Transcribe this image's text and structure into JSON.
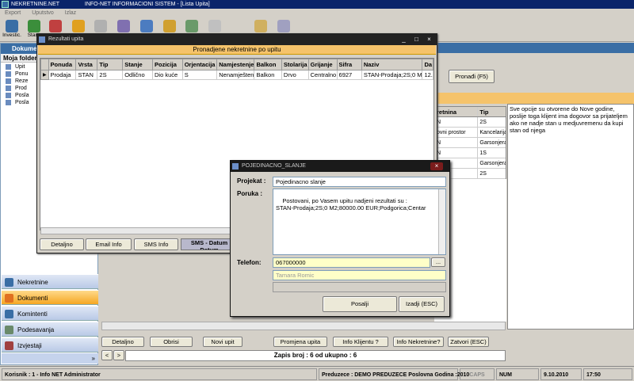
{
  "app": {
    "title": "NEKRETNINE.NET",
    "subtitle": "INFO-NET INFORMACIONI SISTEM - [Lista Upita]",
    "menu": [
      "Export",
      "Uputstvo",
      "Izlaz"
    ]
  },
  "toolbar": {
    "items": [
      {
        "label": "Investic.",
        "icon": "building-icon",
        "color": "#3a6ea5"
      },
      {
        "label": "Stanc",
        "icon": "globe-icon",
        "color": "#3b8e3b"
      },
      {
        "label": "",
        "icon": "house-icon",
        "color": "#c04040"
      },
      {
        "label": "",
        "icon": "chart-icon",
        "color": "#e0a020"
      },
      {
        "label": "",
        "icon": "pencil-icon",
        "color": "#b0b0b0"
      },
      {
        "label": "",
        "icon": "list-icon",
        "color": "#8070b0"
      },
      {
        "label": "",
        "icon": "people-icon",
        "color": "#4c7cc0"
      },
      {
        "label": "",
        "icon": "folder-icon",
        "color": "#d0a030"
      },
      {
        "label": "",
        "icon": "tools-icon",
        "color": "#6a9a6a"
      },
      {
        "label": "",
        "icon": "document-icon",
        "color": "#c0c0c0"
      },
      {
        "label": "",
        "icon": "clipboard-icon",
        "color": "#d0b060"
      },
      {
        "label": "",
        "icon": "note-icon",
        "color": "#a0a0c0"
      }
    ]
  },
  "left_panel": {
    "header": "Dokumen",
    "folder_title": "Moja folder",
    "tree": [
      "Upit",
      "Ponu",
      "Reze",
      "Prod",
      "Posla",
      "Posla"
    ],
    "nav": [
      {
        "label": "Nekretnine",
        "active": false,
        "color": "#3a6ea5"
      },
      {
        "label": "Dokumenti",
        "active": true,
        "color": "#e07020"
      },
      {
        "label": "Komintenti",
        "active": false,
        "color": "#3a6ea5"
      },
      {
        "label": "Podesavanja",
        "active": false,
        "color": "#6a8a6a"
      },
      {
        "label": "Izvjestaji",
        "active": false,
        "color": "#a04040"
      }
    ]
  },
  "background": {
    "find_button": "Pronađi (F5)",
    "grid_headers": [
      "retnina",
      "Tip"
    ],
    "grid_rows": [
      [
        "N",
        "2S"
      ],
      [
        "ovni prostor",
        "Kancelarija"
      ],
      [
        "N",
        "Garsonjera"
      ],
      [
        "N",
        "1S"
      ],
      [
        "",
        "Garsonjera"
      ],
      [
        "",
        "2S"
      ]
    ],
    "description": "Sve opcije su otvorene do Nove godine, poslije toga klijent ima dogovor sa prijateljem ako ne nadje stan u medjuvremenu da kupi stan od njega",
    "bottom_buttons": [
      "Detaljno",
      "Obrisi",
      "Novi upit",
      "Promjena upita",
      "Info Klijentu ?",
      "Info Nekretnine?",
      "Zatvori (ESC)"
    ],
    "records": "Zapis broj : 6 od ukupno : 6"
  },
  "results_window": {
    "title": "Rezultati upita",
    "header": "Pronadjene nekretnine po upitu",
    "columns": [
      "Ponuda",
      "Vrsta",
      "Tip",
      "Stanje",
      "Pozicija",
      "Orjentacija",
      "Namjestenje",
      "Balkon",
      "Stolarija",
      "Grijanje",
      "Sifra",
      "Naziv",
      "Da"
    ],
    "rows": [
      [
        "Prodaja",
        "STAN",
        "2S",
        "Odlično",
        "Dio kuće",
        "S",
        "Nenamješten",
        "Balkon",
        "Drvo",
        "Centralno",
        "6927",
        "STAN-Prodaja;2S;0 M",
        "12."
      ]
    ],
    "buttons": [
      "Detaljno",
      "Email Info",
      "SMS Info"
    ],
    "sms_tab": "SMS - Datum Datum"
  },
  "dialog": {
    "title": "POJEDINACNO_SLANJE",
    "projekat_label": "Projekat :",
    "projekat_value": "Pojedinacno slanje",
    "poruka_label": "Poruka :",
    "poruka_value": "Postovani, po Vasem upitu nadjeni rezultati su :\nSTAN-Prodaja;2S;0 M2;80000.00 EUR;Podgorica;Centar",
    "telefon_label": "Telefon:",
    "telefon_value": "067000000",
    "name_value": "Tamara Romic",
    "browse": "...",
    "send": "Posalji",
    "exit": "Izadji (ESC)"
  },
  "statusbar": {
    "user": "Korisnik : 1 - Info NET  Administrator",
    "company": "Preduzece : DEMO PREDUZECE   Poslovna Godina :2010",
    "caps": "CAPS",
    "num": "NUM",
    "date": "9.10.2010",
    "time": "17:50"
  }
}
